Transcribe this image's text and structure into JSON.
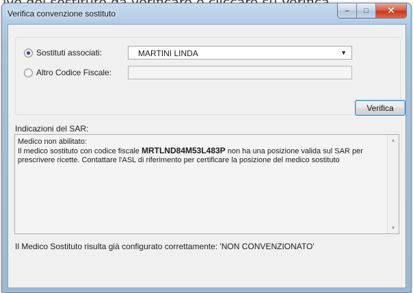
{
  "background_caption": "ive del sostituto da verificare e cliccare su Verifica",
  "window": {
    "title": "Verifica convenzione sostituto",
    "controls": {
      "minimize": "–",
      "maximize": "□",
      "close": "✕"
    }
  },
  "form": {
    "radio_associati": {
      "label": "Sostituti associati:",
      "selected": true
    },
    "combo_sostituto": {
      "value": "MARTINI LINDA",
      "arrow": "▼"
    },
    "radio_altro_cf": {
      "label": "Altro Codice Fiscale:",
      "selected": false
    },
    "altro_cf_input": {
      "value": ""
    },
    "verify_button": "Verifica"
  },
  "sar": {
    "label": "Indicazioni del SAR:",
    "line1": "Medico non abilitato:",
    "line2_prefix": "Il medico sostituto con codice fiscale ",
    "codice_fiscale": "MRTLND84M53L483P",
    "line2_suffix": " non ha una posizione valida sul SAR per prescrivere ricette. Contattare l'ASL di riferimento per certificare la posizione del medico sostituto",
    "scroll_up": "▲",
    "scroll_down": "▼"
  },
  "status": "Il Medico Sostituto risulta già configurato correttamente:  'NON CONVENZIONATO'",
  "colors": {
    "title_bar": "#b3cce6",
    "close_button": "#c23a1c",
    "dialog_bg": "#f0f0f0",
    "button_focus_border": "#3c7fb1"
  }
}
